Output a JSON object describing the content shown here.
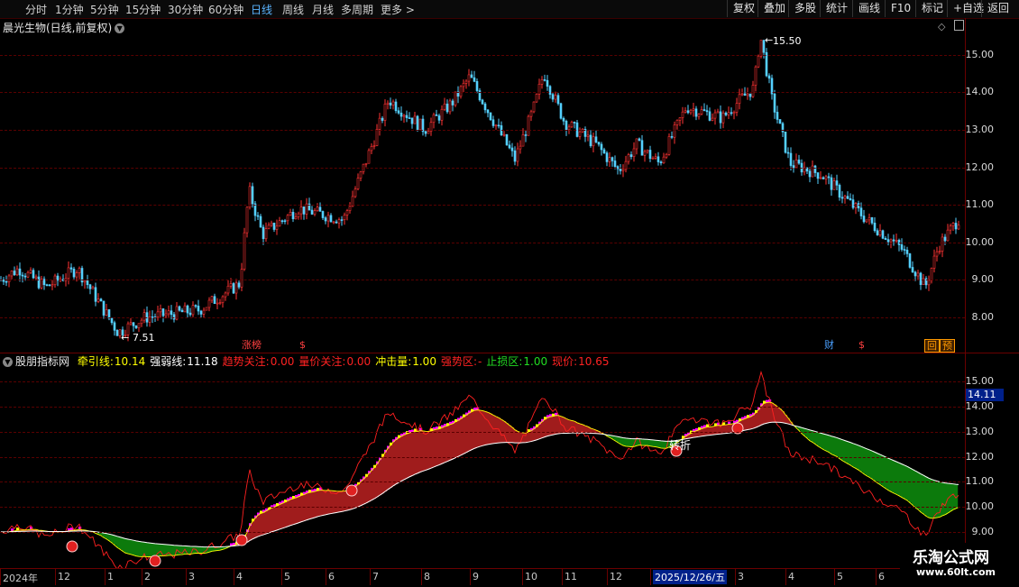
{
  "toolbar": {
    "timeframes": [
      {
        "label": "分时"
      },
      {
        "label": "1分钟"
      },
      {
        "label": "5分钟"
      },
      {
        "label": "15分钟"
      },
      {
        "label": "30分钟"
      },
      {
        "label": "60分钟"
      },
      {
        "label": "日线",
        "active": true
      },
      {
        "label": "周线"
      },
      {
        "label": "月线"
      },
      {
        "label": "多周期"
      },
      {
        "label": "更多 >"
      }
    ],
    "right_buttons": [
      {
        "label": "复权"
      },
      {
        "label": "叠加"
      },
      {
        "label": "多股"
      },
      {
        "label": "统计"
      },
      {
        "label": "画线"
      },
      {
        "label": "F10"
      },
      {
        "label": "标记"
      },
      {
        "label": "+自选"
      },
      {
        "label": "返回"
      }
    ]
  },
  "main_chart": {
    "title": "晨光生物(日线,前复权)",
    "price_ticks": [
      "15.00",
      "14.00",
      "13.00",
      "12.00",
      "11.00",
      "10.00",
      "9.00",
      "8.00"
    ],
    "high_label": "15.50",
    "low_label": "7.51",
    "markers": [
      {
        "text": "涨榜",
        "color": "#ff4040"
      },
      {
        "text": "$",
        "color": "#ff4040"
      },
      {
        "text": "财",
        "color": "#4aa0ff"
      },
      {
        "text": "$",
        "color": "#ff4040"
      },
      {
        "text": "回",
        "color": "#ff9900"
      },
      {
        "text": "预",
        "color": "#ff9900"
      }
    ]
  },
  "indicator": {
    "name": "股朋指标网",
    "items": [
      {
        "label": "牵引线:",
        "value": "10.14",
        "label_color": "#ffff00",
        "value_color": "#ffff00"
      },
      {
        "label": "强弱线:",
        "value": "11.18",
        "label_color": "#ffffff",
        "value_color": "#ffffff"
      },
      {
        "label": "趋势关注:",
        "value": "0.00",
        "label_color": "#ff2222",
        "value_color": "#ff2222"
      },
      {
        "label": "量价关注:",
        "value": "0.00",
        "label_color": "#ff2222",
        "value_color": "#ff2222"
      },
      {
        "label": "冲击量:",
        "value": "1.00",
        "label_color": "#ffff00",
        "value_color": "#ffff00"
      },
      {
        "label": "强势区:",
        "value": "-",
        "label_color": "#ff2222",
        "value_color": "#ff2222"
      },
      {
        "label": "止损区:",
        "value": "1.00",
        "label_color": "#22dd22",
        "value_color": "#22dd22"
      },
      {
        "label": "现价:",
        "value": "10.65",
        "label_color": "#ff2222",
        "value_color": "#ff2222"
      }
    ],
    "axis_ticks": [
      "15.00",
      "14.00",
      "13.00",
      "12.00",
      "11.00",
      "10.00",
      "9.00"
    ],
    "current_value_box": "14.11",
    "annotation": "转折"
  },
  "date_axis": {
    "labels": [
      "2024年",
      "12",
      "1",
      "2",
      "3",
      "4",
      "5",
      "6",
      "7",
      "8",
      "9",
      "10",
      "11",
      "12",
      "2025/12/26/五",
      "3",
      "4",
      "5",
      "6"
    ],
    "highlight": "2025/12/26/五"
  },
  "watermark": {
    "line1": "乐淘公式网",
    "line2": "www.60lt.com"
  },
  "colors": {
    "up": "#ff3333",
    "down": "#54d0ff",
    "bull_fill": "#a01c1c",
    "bear_fill": "#0c7a0c",
    "magenta": "#ff00ff",
    "yellow": "#ffff00"
  }
}
